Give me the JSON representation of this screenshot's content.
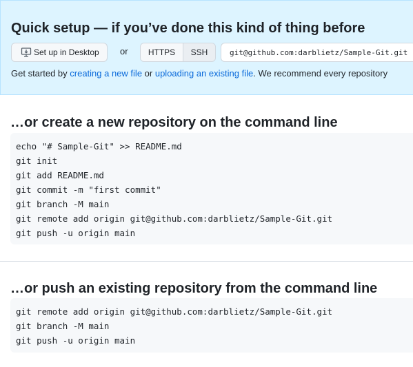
{
  "quick_setup": {
    "title": "Quick setup — if you’ve done this kind of thing before",
    "desktop_button_label": "Set up in Desktop",
    "or_label": "or",
    "protocols": [
      "HTTPS",
      "SSH"
    ],
    "selected_protocol": "SSH",
    "clone_url": "git@github.com:darblietz/Sample-Git.git",
    "get_started": {
      "prefix": "Get started by ",
      "link_new_file": "creating a new file",
      "middle": " or ",
      "link_upload": "uploading an existing file",
      "suffix": ". We recommend every repository"
    }
  },
  "create_section": {
    "title": "…or create a new repository on the command line",
    "lines": [
      "echo \"# Sample-Git\" >> README.md",
      "git init",
      "git add README.md",
      "git commit -m \"first commit\"",
      "git branch -M main",
      "git remote add origin git@github.com:darblietz/Sample-Git.git",
      "git push -u origin main"
    ]
  },
  "push_section": {
    "title": "…or push an existing repository from the command line",
    "lines": [
      "git remote add origin git@github.com:darblietz/Sample-Git.git",
      "git branch -M main",
      "git push -u origin main"
    ]
  },
  "colors": {
    "banner_bg": "#ddf4ff",
    "link": "#0969da",
    "code_bg": "#f6f8fa"
  }
}
